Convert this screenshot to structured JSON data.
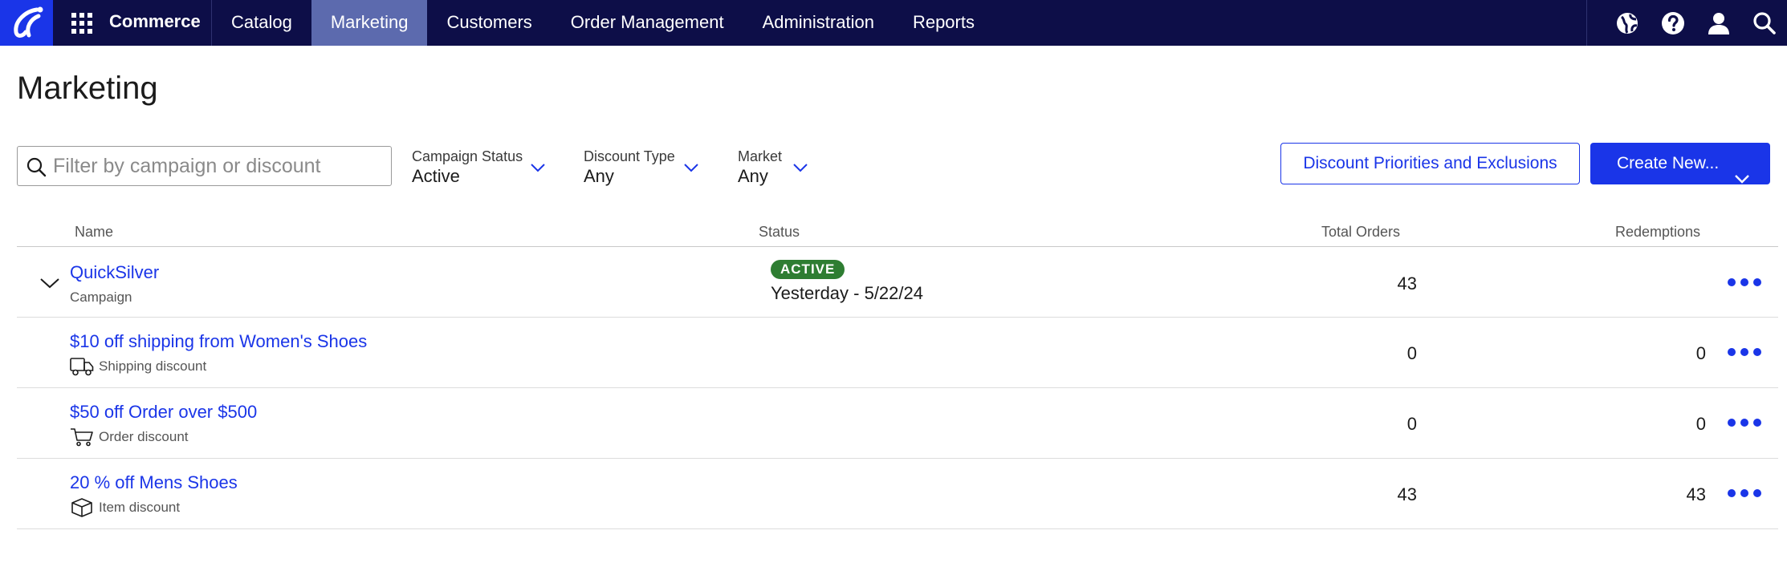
{
  "topbar": {
    "brand": "Commerce",
    "nav": [
      {
        "label": "Catalog",
        "active": false
      },
      {
        "label": "Marketing",
        "active": true
      },
      {
        "label": "Customers",
        "active": false
      },
      {
        "label": "Order Management",
        "active": false
      },
      {
        "label": "Administration",
        "active": false
      },
      {
        "label": "Reports",
        "active": false
      }
    ],
    "icons": [
      "globe-icon",
      "help-icon",
      "user-icon",
      "search-icon"
    ]
  },
  "page": {
    "title": "Marketing"
  },
  "filters": {
    "search_placeholder": "Filter by campaign or discount",
    "campaign_status": {
      "label": "Campaign Status",
      "value": "Active"
    },
    "discount_type": {
      "label": "Discount Type",
      "value": "Any"
    },
    "market": {
      "label": "Market",
      "value": "Any"
    }
  },
  "actions": {
    "priorities_label": "Discount Priorities and Exclusions",
    "create_label": "Create New..."
  },
  "table": {
    "columns": {
      "name": "Name",
      "status": "Status",
      "total_orders": "Total Orders",
      "redemptions": "Redemptions"
    },
    "rows": [
      {
        "name": "QuickSilver",
        "type": "Campaign",
        "status_badge": "ACTIVE",
        "date_range": "Yesterday - 5/22/24",
        "total_orders": "43",
        "redemptions": "",
        "icon": "chevron-down-icon"
      },
      {
        "name": "$10 off shipping from Women's Shoes",
        "type": "Shipping discount",
        "total_orders": "0",
        "redemptions": "0",
        "icon": "truck-icon"
      },
      {
        "name": "$50 off Order over $500",
        "type": "Order discount",
        "total_orders": "0",
        "redemptions": "0",
        "icon": "cart-icon"
      },
      {
        "name": "20 % off Mens Shoes",
        "type": "Item discount",
        "total_orders": "43",
        "redemptions": "43",
        "icon": "box-icon"
      }
    ]
  },
  "colors": {
    "topbar": "#0d0e48",
    "accent": "#1a35e8",
    "active_nav": "#5c6aae",
    "badge": "#2e7d32"
  }
}
